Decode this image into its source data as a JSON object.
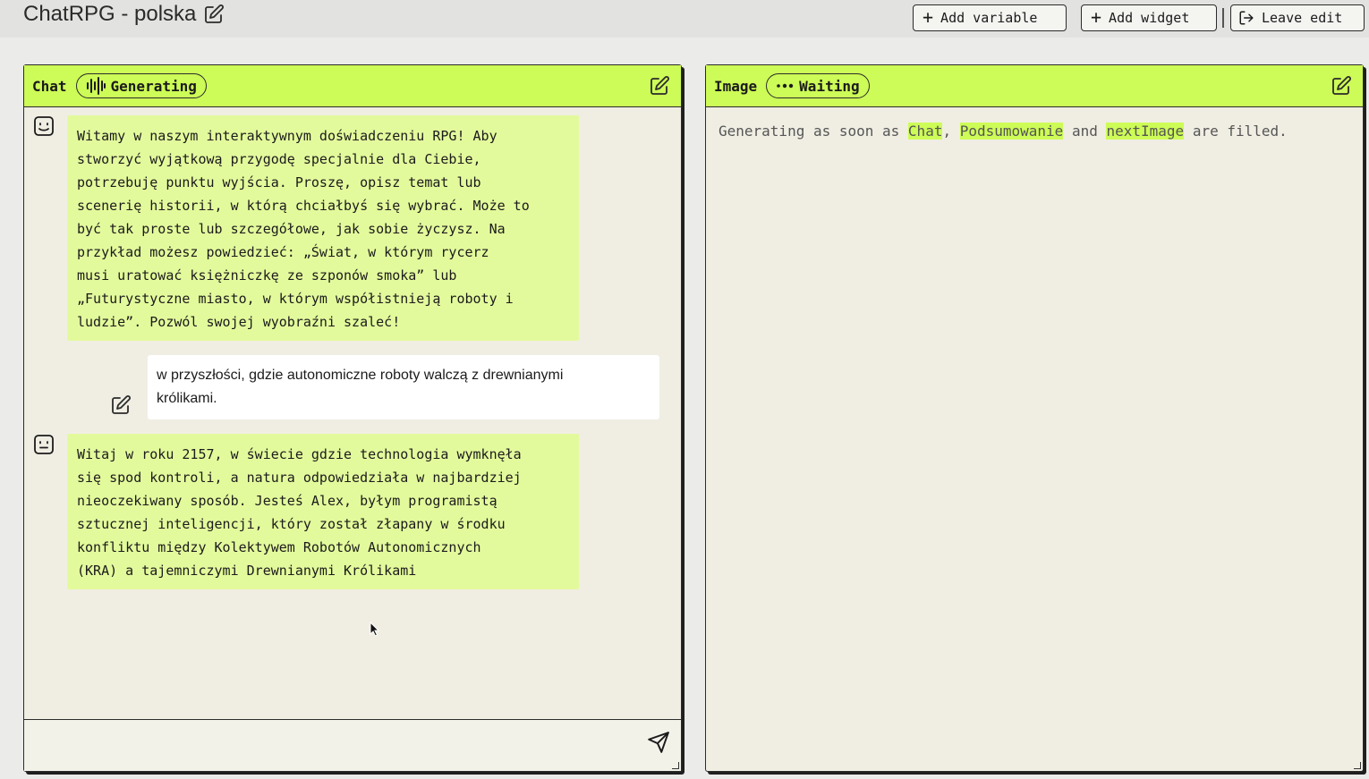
{
  "app": {
    "title": "ChatRPG - polska",
    "title_edit_icon": "edit-icon"
  },
  "toolbar": {
    "add_variable": "Add variable",
    "add_widget": "Add widget",
    "leave_edit": "Leave edit",
    "plus_glyph": "+"
  },
  "chat_panel": {
    "title": "Chat",
    "status": "Generating",
    "status_icon": "audio-wave-icon",
    "messages": [
      {
        "role": "bot",
        "text": "Witamy w naszym interaktywnym doświadczeniu RPG! Aby\nstworzyć wyjątkową przygodę specjalnie dla Ciebie,\npotrzebuję punktu wyjścia. Proszę, opisz temat lub\nscenerię historii, w którą chciałbyś się wybrać. Może to\nbyć tak proste lub szczegółowe, jak sobie życzysz. Na\nprzykład możesz powiedzieć: „Świat, w którym rycerz\nmusi uratować księżniczkę ze szponów smoka” lub\n„Futurystyczne miasto, w którym współistnieją roboty i\nludzie”. Pozwól swojej wyobraźni szaleć!"
      },
      {
        "role": "user",
        "text": "w przyszłości, gdzie autonomiczne roboty walczą z drewnianymi\nkrólikami."
      },
      {
        "role": "bot",
        "text": "Witaj w roku 2157, w świecie gdzie technologia wymknęła\nsię spod kontroli, a natura odpowiedziała w najbardziej\nnieoczekiwany sposób. Jesteś Alex, byłym programistą\nsztucznej inteligencji, który został złapany w środku\nkonfliktu między Kolektywem Robotów Autonomicznych\n(KRA) a tajemniczymi Drewnianymi Królikami"
      }
    ],
    "input_value": "",
    "send_icon": "send-icon"
  },
  "image_panel": {
    "title": "Image",
    "status": "Waiting",
    "status_icon": "ellipsis-icon",
    "waiting": {
      "prefix": "Generating as soon as ",
      "var1": "Chat",
      "sep1": ", ",
      "var2": "Podsumowanie",
      "sep2": " and ",
      "var3": "nextImage",
      "suffix": " are filled."
    }
  },
  "colors": {
    "accent": "#cdfb57",
    "bot_bubble": "#e3fa9c",
    "panel_bg": "#f0eee3",
    "page_bg": "#ebebe9"
  }
}
